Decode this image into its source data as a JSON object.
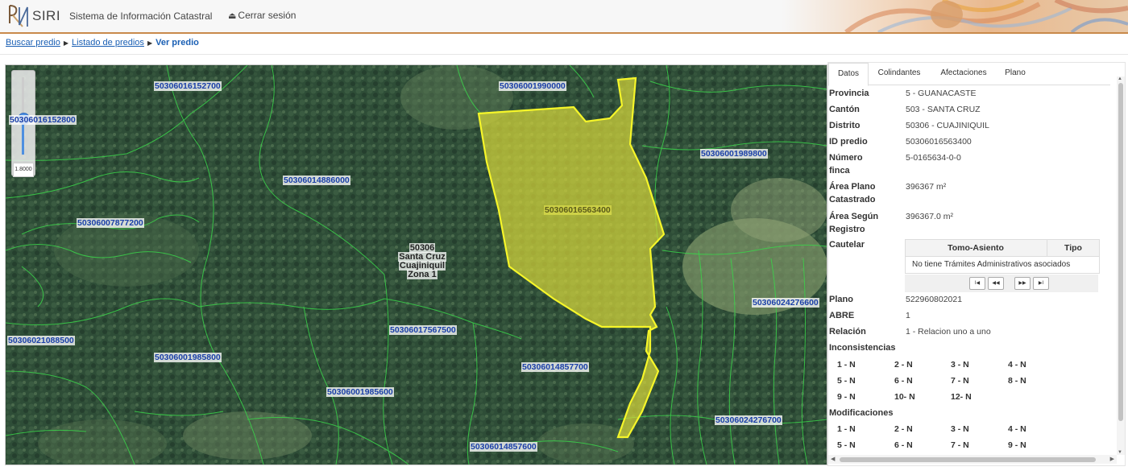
{
  "header": {
    "brand": "SIRI",
    "subtitle": "Sistema de Información Catastral",
    "logout_label": "Cerrar sesión"
  },
  "breadcrumb": {
    "items": [
      "Buscar predio",
      "Listado de predios"
    ],
    "current": "Ver predio"
  },
  "map": {
    "zoom_value": "1.8000",
    "zone_label": [
      "50306",
      "Santa Cruz",
      "Cuajiniquil",
      "Zona 1"
    ],
    "parcels": [
      "50306016152700",
      "50306001990000",
      "50306016152800",
      "50306001989800",
      "50306014886000",
      "50306016563400",
      "50306007877200",
      "50306024276600",
      "50306017567500",
      "50306021088500",
      "50306001985800",
      "50306014857700",
      "50306001985600",
      "50306024276700",
      "50306014857600"
    ]
  },
  "panel": {
    "tabs": [
      "Datos",
      "Colindantes",
      "Afectaciones",
      "Plano"
    ],
    "fields": [
      {
        "label": "Provincia",
        "value": "5 - GUANACASTE"
      },
      {
        "label": "Cantón",
        "value": "503 - SANTA CRUZ"
      },
      {
        "label": "Distrito",
        "value": "50306 - CUAJINIQUIL"
      },
      {
        "label": "ID predio",
        "value": "50306016563400"
      },
      {
        "label": "Número finca",
        "value": "5-0165634-0-0"
      },
      {
        "label": "Área Plano Catastrado",
        "value": "396367 m²"
      },
      {
        "label": "Área Según Registro",
        "value": "396367.0 m²"
      }
    ],
    "cautelar": {
      "label": "Cautelar",
      "col1": "Tomo-Asiento",
      "col2": "Tipo",
      "empty": "No tiene Trámites Administrativos asociados",
      "pager": [
        "I◀",
        "◀◀",
        "▶▶",
        "▶I"
      ]
    },
    "fields2": [
      {
        "label": "Plano",
        "value": "522960802021"
      },
      {
        "label": "ABRE",
        "value": "1"
      },
      {
        "label": "Relación",
        "value": "1 - Relacion uno a uno"
      }
    ],
    "inconsistencias": {
      "label": "Inconsistencias",
      "items": [
        "1 -  N",
        "2 -  N",
        "3 -  N",
        "4 -  N",
        "5 -  N",
        "6 -  N",
        "7 -  N",
        "8 -  N",
        "9 -  N",
        "10-  N",
        "12-  N"
      ]
    },
    "modificaciones": {
      "label": "Modificaciones",
      "items": [
        "1 -  N",
        "2 -  N",
        "3 -  N",
        "4 -  N",
        "5 -  N",
        "6 -  N",
        "7 -  N",
        "9 -  N"
      ]
    }
  }
}
